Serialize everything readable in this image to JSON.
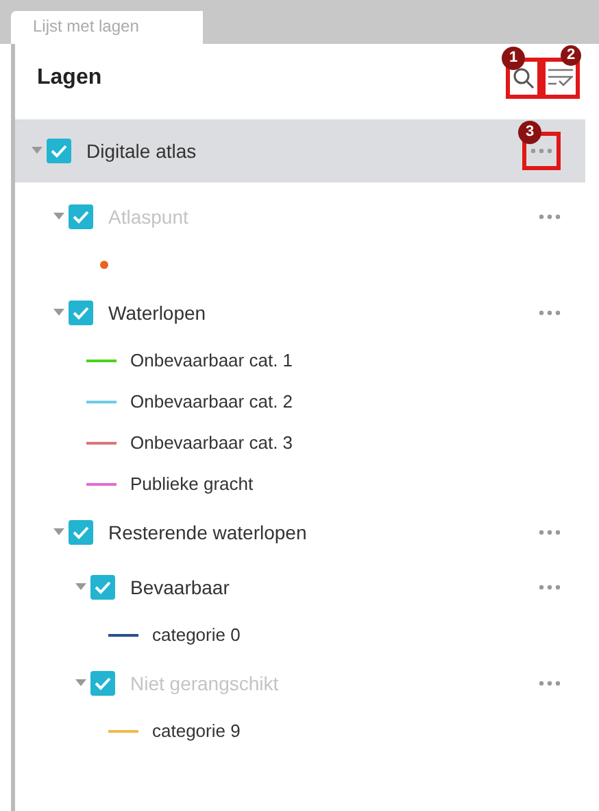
{
  "tab": {
    "label": "Lijst met lagen",
    "selected": true
  },
  "header": {
    "title": "Lagen",
    "search_callout": "1",
    "filter_callout": "2"
  },
  "layers": [
    {
      "kind": "layer",
      "name": "Digitale atlas",
      "checked": true,
      "expanded": true,
      "disabled": false,
      "selected": true,
      "callout": "3",
      "children": [
        {
          "kind": "layer",
          "name": "Atlaspunt",
          "checked": true,
          "expanded": true,
          "disabled": true,
          "selected": false,
          "children": [
            {
              "kind": "dot",
              "color": "#e8641e"
            }
          ]
        },
        {
          "kind": "layer",
          "name": "Waterlopen",
          "checked": true,
          "expanded": true,
          "disabled": false,
          "selected": false,
          "children": [
            {
              "kind": "line",
              "color": "#4cd11c",
              "label": "Onbevaarbaar cat. 1"
            },
            {
              "kind": "line",
              "color": "#6fcbea",
              "label": "Onbevaarbaar cat. 2"
            },
            {
              "kind": "line",
              "color": "#d9767b",
              "label": "Onbevaarbaar cat. 3"
            },
            {
              "kind": "line",
              "color": "#e36ad6",
              "label": "Publieke gracht"
            }
          ]
        },
        {
          "kind": "layer",
          "name": "Resterende waterlopen",
          "checked": true,
          "expanded": true,
          "disabled": false,
          "selected": false,
          "children": [
            {
              "kind": "layer",
              "name": "Bevaarbaar",
              "checked": true,
              "expanded": true,
              "disabled": false,
              "selected": false,
              "children": [
                {
                  "kind": "line",
                  "color": "#2a4f8f",
                  "label": "categorie 0"
                }
              ]
            },
            {
              "kind": "layer",
              "name": "Niet gerangschikt",
              "checked": true,
              "expanded": true,
              "disabled": true,
              "selected": false,
              "children": [
                {
                  "kind": "line",
                  "color": "#f0b94a",
                  "label": "categorie 9"
                }
              ]
            }
          ]
        }
      ]
    }
  ]
}
